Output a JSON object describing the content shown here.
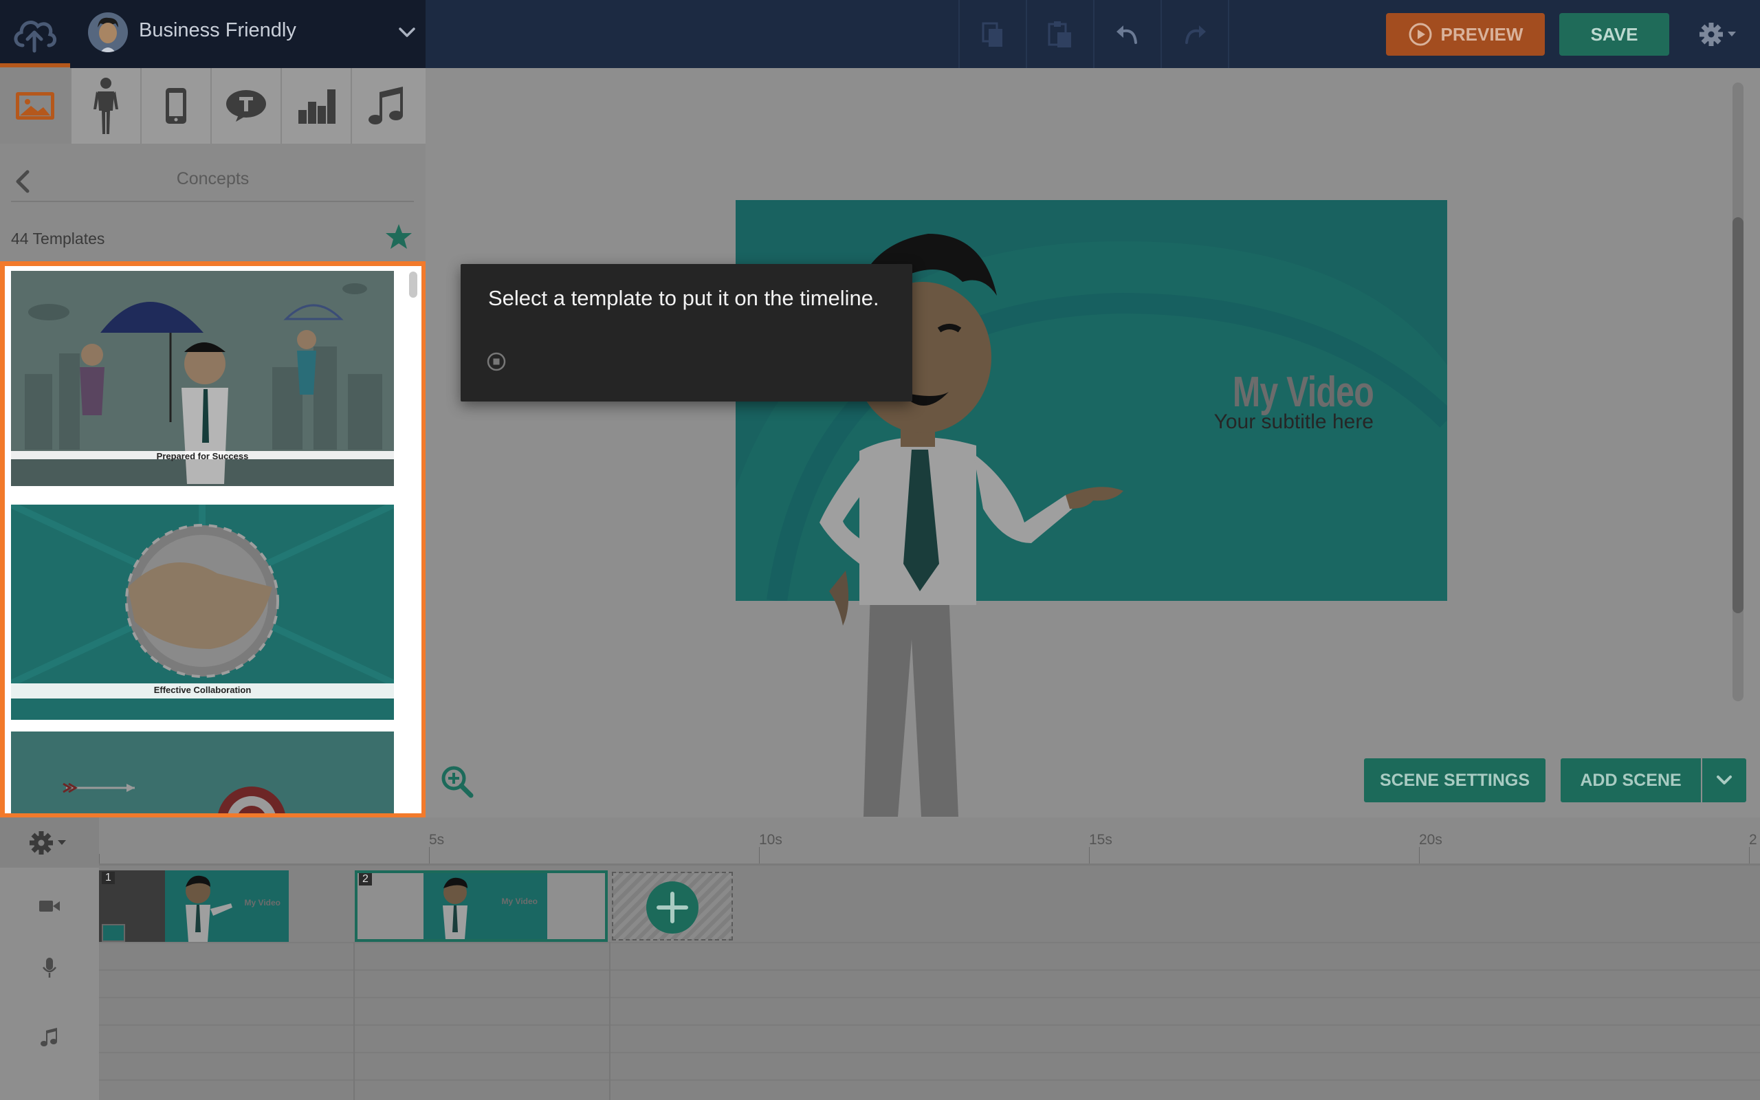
{
  "header": {
    "theme_name": "Business Friendly",
    "preview_label": "PREVIEW",
    "save_label": "SAVE"
  },
  "left_panel": {
    "tabs": [
      "backgrounds",
      "characters",
      "props",
      "text",
      "charts",
      "music"
    ],
    "breadcrumb_title": "Concepts",
    "templates_count": "44 Templates",
    "templates": [
      {
        "caption": "Prepared for Success"
      },
      {
        "caption": "Effective Collaboration"
      },
      {
        "caption": ""
      }
    ]
  },
  "stage": {
    "video_title": "My Video",
    "video_subtitle": "Your subtitle here",
    "tooltip_text": "Select a template to put it on the timeline.",
    "scene_settings_label": "SCENE SETTINGS",
    "add_scene_label": "ADD SCENE"
  },
  "timeline": {
    "ruler_labels": [
      "5s",
      "10s",
      "15s",
      "20s",
      "2"
    ],
    "scenes": [
      {
        "number": "1",
        "thumb_title": "My Video"
      },
      {
        "number": "2",
        "thumb_title": "My Video"
      }
    ]
  },
  "colors": {
    "accent_orange": "#f27a2b",
    "teal": "#1a6762",
    "save_green": "#1f6b59"
  }
}
